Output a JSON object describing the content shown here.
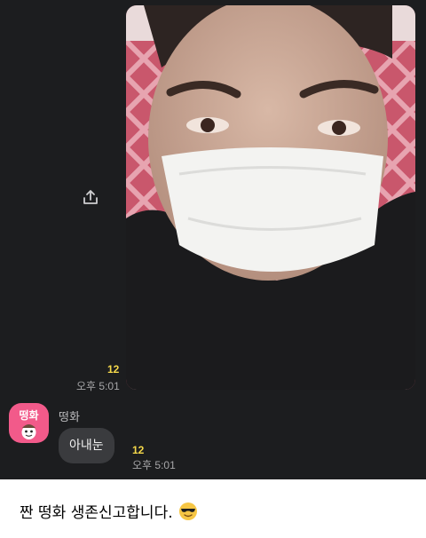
{
  "chat": {
    "photo_message": {
      "unread_count": "12",
      "time": "오후 5:01"
    },
    "text_message": {
      "sender_name": "떵화",
      "avatar_text": "떵화",
      "text": "아내눈",
      "unread_count": "12",
      "time": "오후 5:01"
    }
  },
  "caption": {
    "text": "짠 떵화 생존신고합니다.",
    "emoji": "smiling-face-with-sunglasses"
  },
  "colors": {
    "chat_background": "#1c1d1f",
    "bubble": "#3a3b3e",
    "unread": "#f5d84a",
    "avatar": "#f25a8a"
  }
}
